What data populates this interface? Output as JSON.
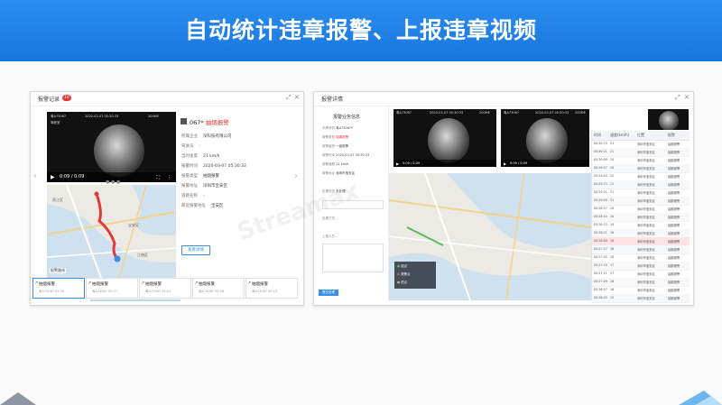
{
  "slide_title": "自动统计违章报警、上报违章视频",
  "left": {
    "header": {
      "title": "报警记录",
      "badge": "10"
    },
    "video": {
      "tag": "粤A73067",
      "date": "2020-03-07 05:30:33",
      "id": "200ME",
      "channel": "驾驶室",
      "time": "0:09 / 0:09"
    },
    "info": {
      "plate": "067*",
      "alarm": "抽烟报警",
      "rows": [
        {
          "label": "所属企业",
          "value": "深科技有限公司"
        },
        {
          "label": "驾驶员",
          "value": "-"
        },
        {
          "label": "当时速度",
          "value": "21 km/h"
        },
        {
          "label": "报警时间",
          "value": "2020-03-07 05:30:33"
        },
        {
          "label": "报警类型",
          "value": "抽烟报警"
        },
        {
          "label": "报警地址",
          "value": "深圳市宝安区"
        },
        {
          "label": "道路名称",
          "value": "-"
        },
        {
          "label": "最近报警地址",
          "value": "宝安区"
        }
      ],
      "button": "查看详情"
    },
    "map": {
      "labels": [
        "燕江区",
        "宝安区",
        "江南区"
      ],
      "legend": "报警路线"
    },
    "cards": [
      {
        "title": "抽烟报警",
        "sub": "粤A73067 05:30"
      },
      {
        "title": "抽烟报警",
        "sub": "粤A73067 05:27"
      },
      {
        "title": "抽烟报警",
        "sub": "粤A73067 05:21"
      },
      {
        "title": "抽烟报警",
        "sub": "粤A73067 05:18"
      },
      {
        "title": "抽烟报警",
        "sub": "粤A73067 05:12"
      }
    ]
  },
  "right": {
    "header": {
      "title": "报警详情"
    },
    "form": {
      "title": "报警业务信息",
      "rows": [
        {
          "label": "车牌号码",
          "value": "粤A73067*"
        },
        {
          "label": "报警类型",
          "value": "抽烟报警"
        },
        {
          "label": "报警级别",
          "value": "一级报警"
        },
        {
          "label": "报警时间",
          "value": "2020-03-07 05:30:33"
        },
        {
          "label": "报警速度",
          "value": "21 km/h"
        },
        {
          "label": "报警地址",
          "value": "深圳市宝安区"
        },
        {
          "label": "处理状态",
          "value": "未处理"
        },
        {
          "label": "处理方式",
          "value": "-"
        },
        {
          "label": "上报人员",
          "value": "-"
        }
      ],
      "button": "提交处理"
    },
    "videos": [
      {
        "tag": "粤A73067",
        "date": "2020-03-07 05:30:33",
        "id": "200ME",
        "time": "0:09 / 0:09"
      },
      {
        "tag": "粤A73067",
        "date": "2020-03-07 05:30:33",
        "id": "200ME",
        "time": "0:09 / 0:09"
      }
    ],
    "table": {
      "headers": [
        "时间",
        "速度(km/h)",
        "位置",
        "报警"
      ],
      "rows": [
        [
          "05:30:33",
          "21",
          "深圳市宝安区",
          "抽烟报警"
        ],
        [
          "05:30:21",
          "21",
          "深圳市宝安区",
          "抽烟报警"
        ],
        [
          "05:30:09",
          "20",
          "深圳市宝安区",
          "抽烟报警"
        ],
        [
          "05:29:57",
          "20",
          "深圳市宝安区",
          "抽烟报警"
        ],
        [
          "05:29:45",
          "22",
          "深圳市宝安区",
          "抽烟报警"
        ],
        [
          "05:29:33",
          "22",
          "深圳市宝安区",
          "抽烟报警"
        ],
        [
          "05:29:21",
          "21",
          "深圳市宝安区",
          "抽烟报警"
        ],
        [
          "05:29:09",
          "21",
          "深圳市宝安区",
          "抽烟报警"
        ],
        [
          "05:28:57",
          "20",
          "深圳市宝安区",
          "抽烟报警"
        ],
        [
          "05:28:45",
          "20",
          "深圳市宝安区",
          "抽烟报警"
        ],
        [
          "05:28:33",
          "19",
          "深圳市宝安区",
          "抽烟报警"
        ],
        [
          "05:28:21",
          "19",
          "深圳市宝安区",
          "抽烟报警"
        ],
        [
          "05:28:09",
          "18",
          "深圳市宝安区",
          "抽烟报警"
        ],
        [
          "05:27:57",
          "18",
          "深圳市宝安区",
          "抽烟报警"
        ],
        [
          "05:27:45",
          "18",
          "深圳市宝安区",
          "抽烟报警"
        ],
        [
          "05:27:33",
          "17",
          "深圳市宝安区",
          "抽烟报警"
        ],
        [
          "05:27:21",
          "17",
          "深圳市宝安区",
          "抽烟报警"
        ],
        [
          "05:27:09",
          "16",
          "深圳市宝安区",
          "抽烟报警"
        ],
        [
          "05:26:57",
          "16",
          "深圳市宝安区",
          "抽烟报警"
        ],
        [
          "05:26:45",
          "15",
          "深圳市宝安区",
          "抽烟报警"
        ]
      ]
    },
    "map_legend": [
      {
        "label": "起点"
      },
      {
        "label": "报警点"
      },
      {
        "label": "终点"
      }
    ]
  },
  "watermark": "Streamax",
  "colors": {
    "banner": "#1f82e8",
    "accent": "#3b8ee8",
    "alarm": "#e03a3a"
  }
}
